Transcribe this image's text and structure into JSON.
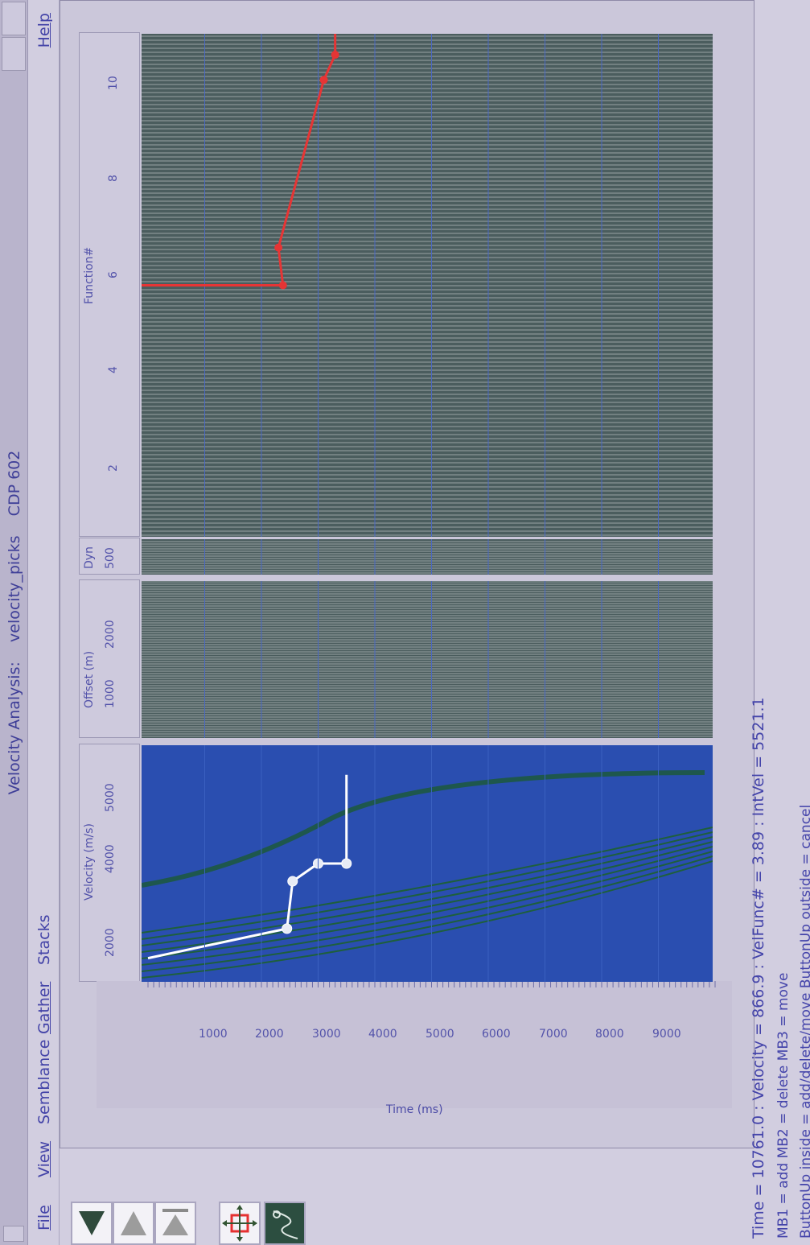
{
  "window": {
    "title_prefix": "Velocity Analysis:",
    "file_name": "velocity_picks",
    "cdp": "CDP 602"
  },
  "menu": {
    "file": "File",
    "view": "View",
    "semblance": "Semblance",
    "gather": "Gather",
    "stacks": "Stacks",
    "help": "Help"
  },
  "tools": {
    "icons": [
      "triangle-up-icon",
      "triangle-down-icon",
      "triangle-down-bar-icon",
      "move-cursor-icon",
      "velocity-curve-icon"
    ]
  },
  "time_axis": {
    "label": "Time (ms)",
    "ticks": [
      "1000",
      "2000",
      "3000",
      "4000",
      "5000",
      "6000",
      "7000",
      "8000",
      "9000"
    ]
  },
  "velocity_panel": {
    "label": "Velocity (m/s)",
    "ticks": [
      "2000",
      "4000",
      "5000"
    ],
    "picks": [
      {
        "v": 1900,
        "t": 0
      },
      {
        "v": 2400,
        "t": 2450
      },
      {
        "v": 3200,
        "t": 2550
      },
      {
        "v": 3500,
        "t": 3000
      },
      {
        "v": 3500,
        "t": 3500
      },
      {
        "v": 3500,
        "t": 3500
      },
      {
        "v": 5000,
        "t": 3500
      }
    ],
    "colors": {
      "background": "#2a4eb0",
      "pick_line": "#ffffff",
      "contour": "#1e5f3c"
    }
  },
  "gather_panel": {
    "label": "Offset (m)",
    "ticks": [
      "1000",
      "2000"
    ]
  },
  "dyn_panel": {
    "label": "Dyn",
    "ticks": [
      "500"
    ]
  },
  "stacks_panel": {
    "label": "Function#",
    "ticks": [
      "2",
      "4",
      "6",
      "8",
      "10"
    ],
    "pick_color": "#e63535",
    "picks": [
      {
        "f": 6.0,
        "t": 2380
      },
      {
        "f": 6.9,
        "t": 2300
      },
      {
        "f": 10.9,
        "t": 3100
      },
      {
        "f": 11.5,
        "t": 3300
      }
    ]
  },
  "status": {
    "readout": "Time =  10761.0 : Velocity =    866.9 : VelFunc# =  3.89 : IntVel =    5521.1",
    "hint1": "MB1 = add  MB2 = delete  MB3 = move",
    "hint2": "ButtonUp inside = add/delete/move  ButtonUp outside = cancel"
  }
}
